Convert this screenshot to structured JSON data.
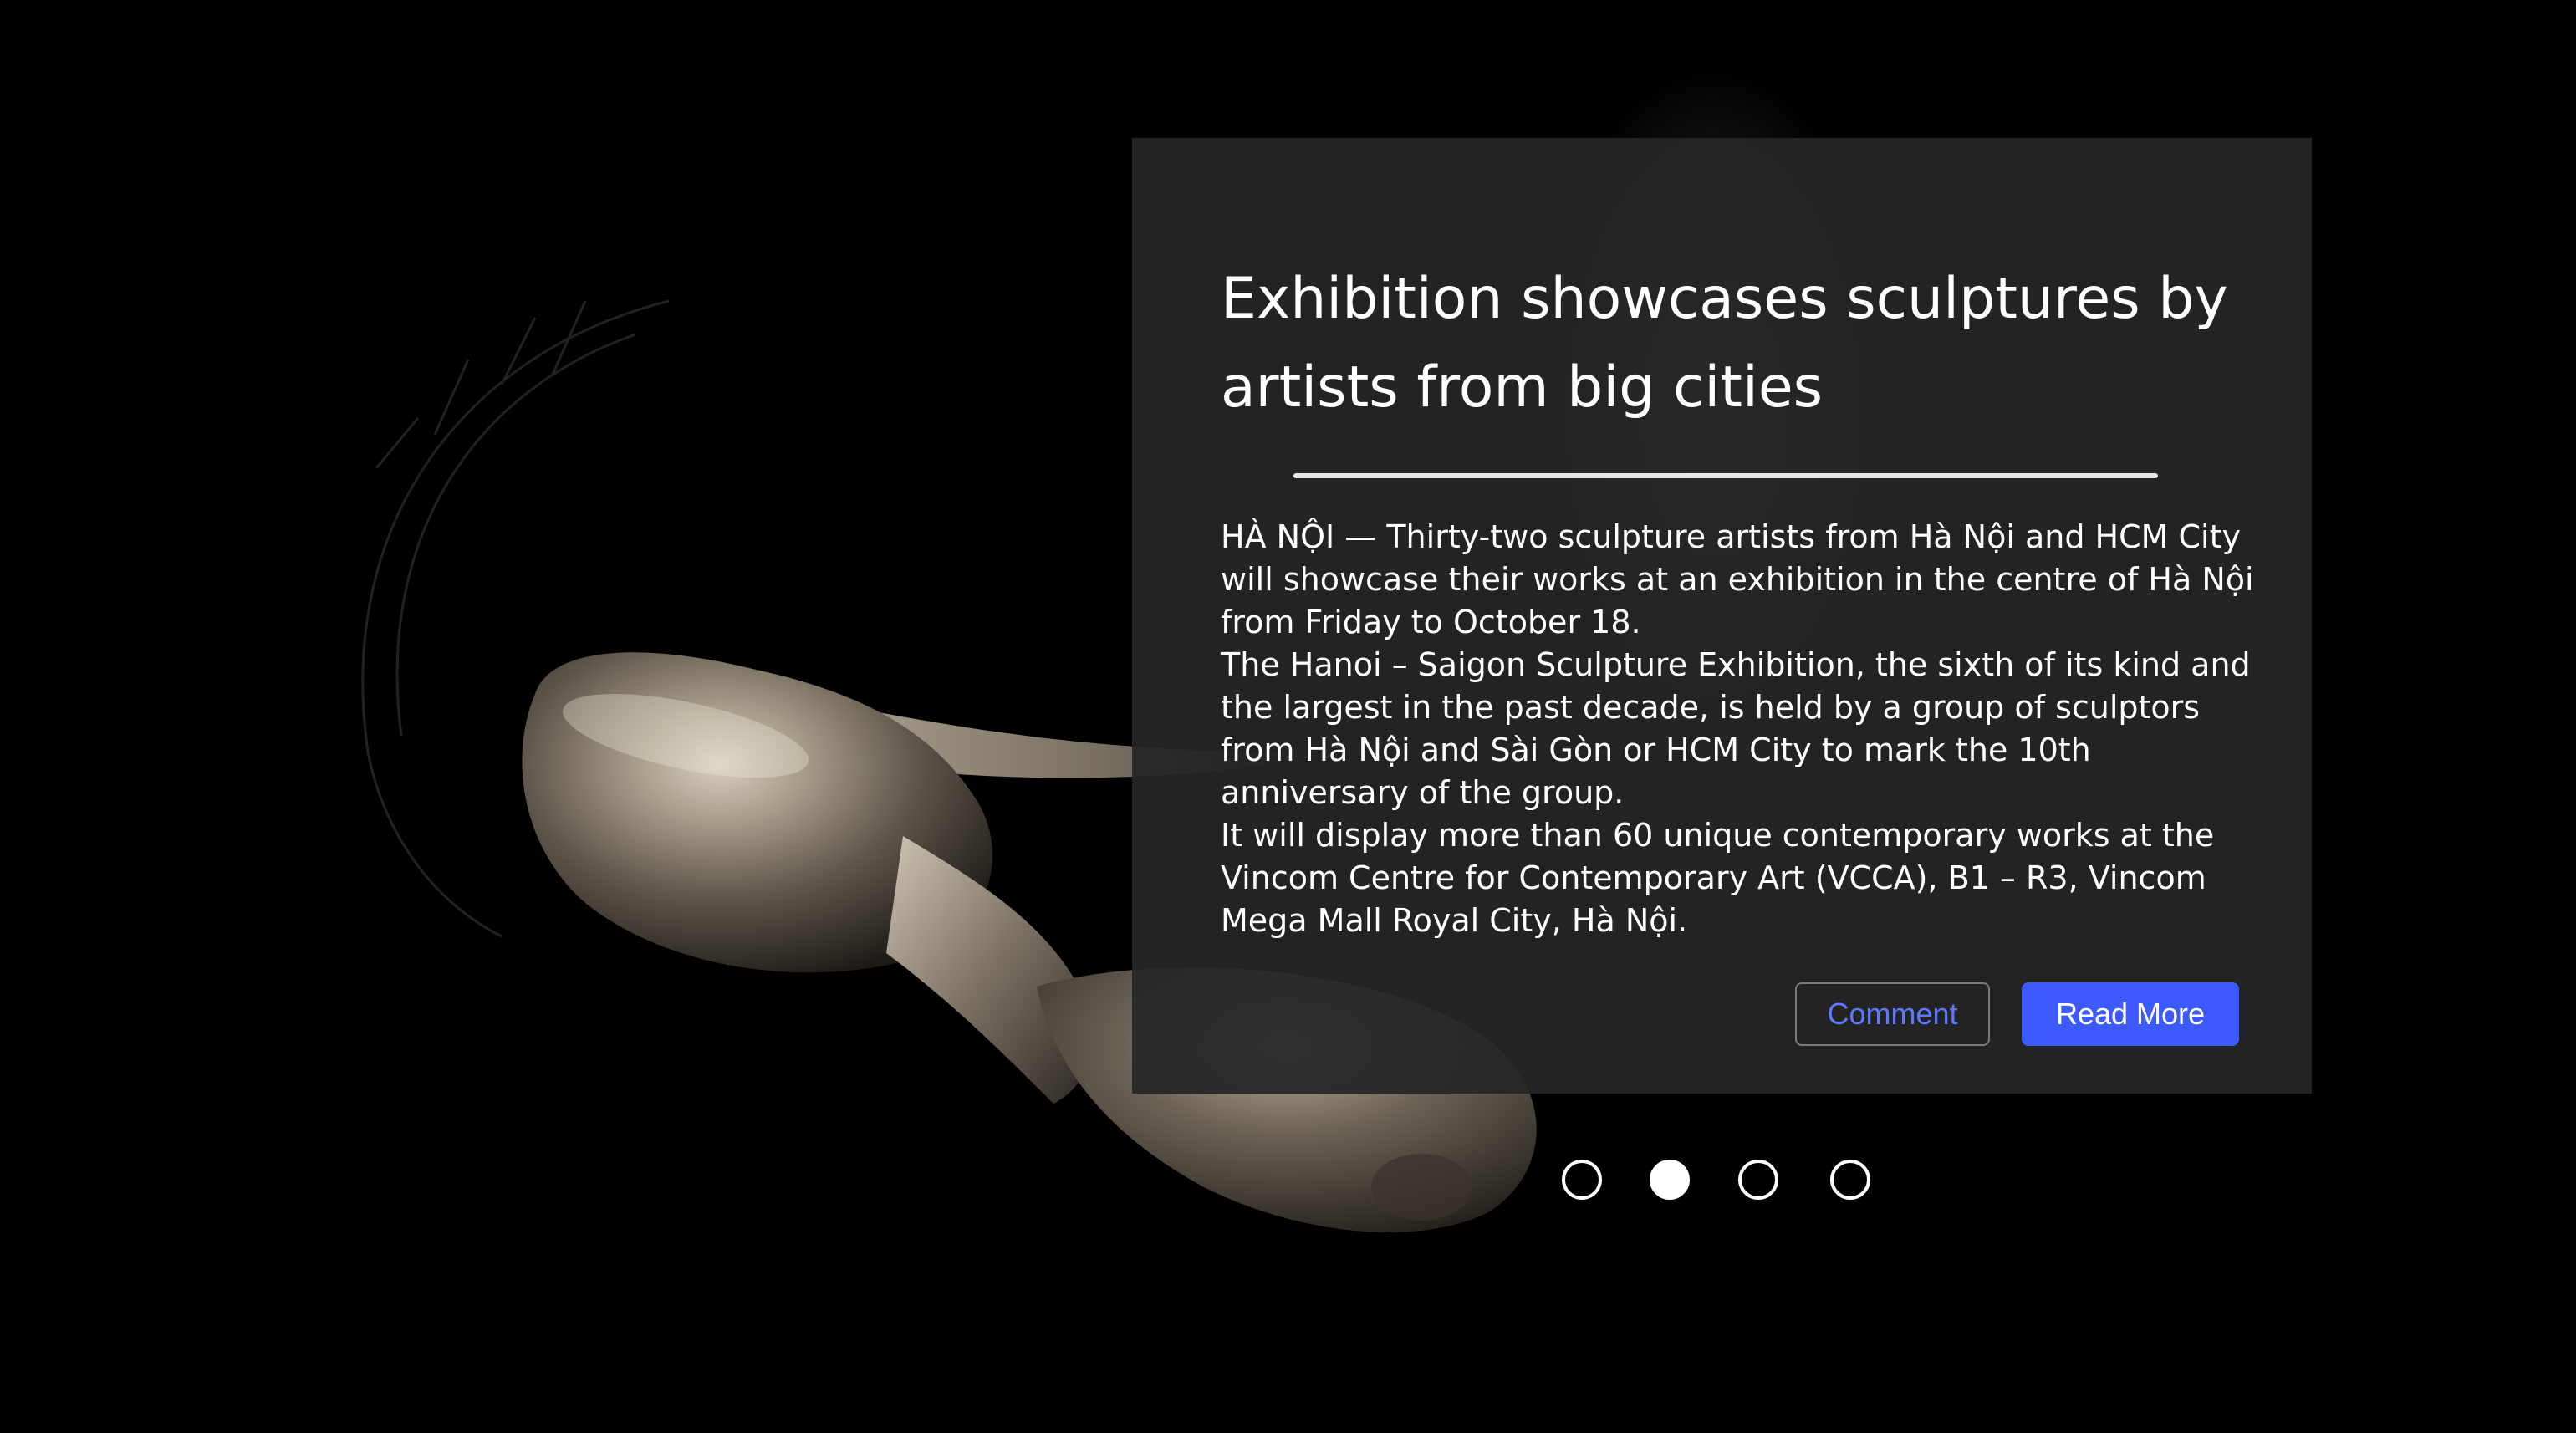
{
  "article": {
    "title": "Exhibition showcases sculptures by artists from big cities",
    "paragraphs": [
      "HÀ NỘI — Thirty-two sculpture artists from Hà Nội and HCM City will showcase their works at an exhibition in the centre of Hà Nội from Friday to October 18.",
      "The Hanoi – Saigon Sculpture Exhibition, the sixth of its kind and the largest in the past decade, is held by a group of sculptors from Hà Nội and Sài Gòn or HCM City to mark the 10th anniversary of the group.",
      "It will display more than 60 unique contemporary works at the Vincom Centre for Contemporary Art (VCCA), B1 – R3, Vincom Mega Mall Royal City, Hà Nội."
    ]
  },
  "actions": {
    "comment_label": "Comment",
    "read_more_label": "Read More"
  },
  "carousel": {
    "slide_count": 4,
    "active_index": 1
  },
  "colors": {
    "background": "#000000",
    "panel": "#262626",
    "accent": "#3d5afe",
    "comment_text": "#5b78ff"
  },
  "icons": [
    "carousel-dot"
  ]
}
